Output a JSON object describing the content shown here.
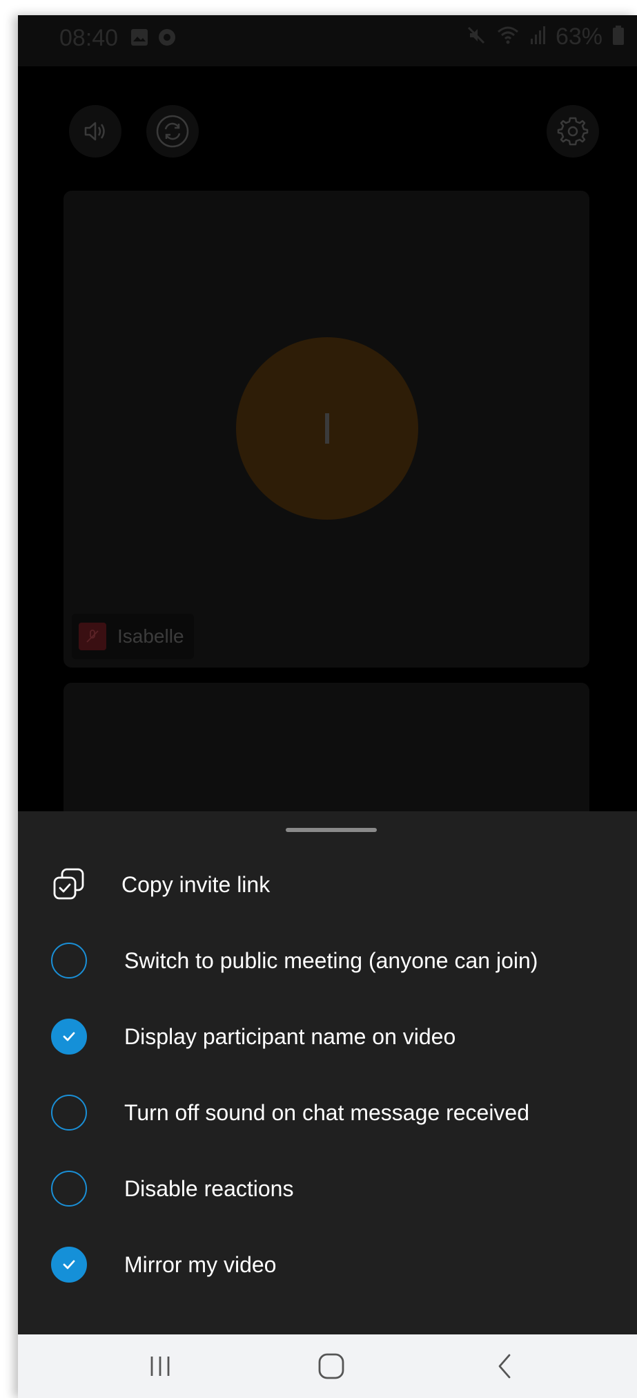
{
  "status_bar": {
    "time": "08:40",
    "battery": "63%",
    "icons": [
      "gallery-icon",
      "app-notification-icon",
      "mute-icon",
      "wifi-icon",
      "signal-icon",
      "battery-icon"
    ]
  },
  "call": {
    "top_buttons": [
      "speaker-icon",
      "switch-camera-icon",
      "settings-icon"
    ],
    "participant": {
      "initial": "I",
      "name": "Isabelle",
      "avatar_color": "#2e1d07"
    }
  },
  "sheet": {
    "items": [
      {
        "label": "Copy invite link",
        "icon": "copy-link-icon"
      },
      {
        "label": "Switch to public meeting (anyone can join)",
        "checked": false
      },
      {
        "label": "Display participant name on video",
        "checked": true
      },
      {
        "label": "Turn off sound on chat message received",
        "checked": false
      },
      {
        "label": "Disable reactions",
        "checked": false
      },
      {
        "label": "Mirror my video",
        "checked": true
      }
    ],
    "accent": "#1590d8"
  },
  "nav_bar": {
    "buttons": [
      "recent-apps-icon",
      "home-icon",
      "back-icon"
    ]
  }
}
